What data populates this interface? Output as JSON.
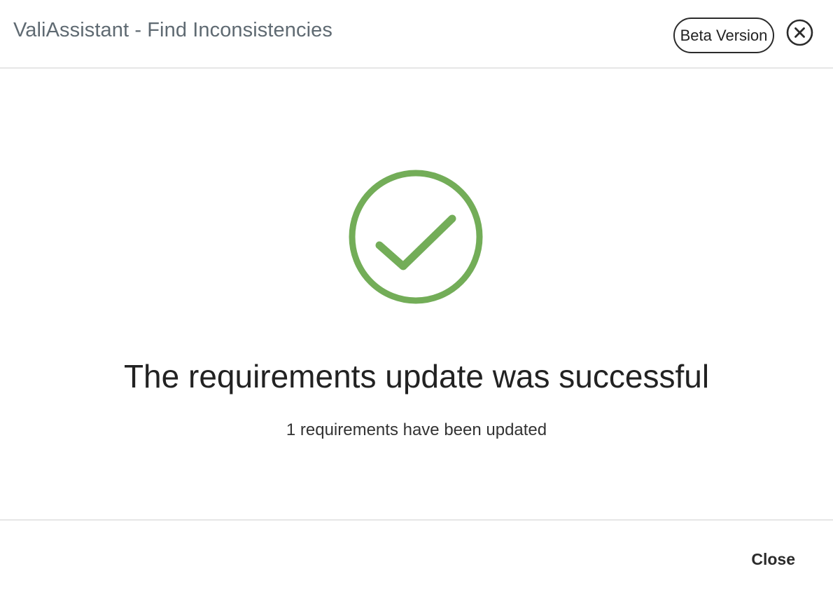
{
  "header": {
    "title": "ValiAssistant - Find Inconsistencies",
    "badge": "Beta Version",
    "close_icon": "close-circle-icon"
  },
  "status": {
    "icon": "success-check-icon",
    "icon_color": "#73ad58",
    "headline": "The requirements update was successful",
    "detail": "1 requirements have been updated"
  },
  "footer": {
    "close_label": "Close"
  }
}
